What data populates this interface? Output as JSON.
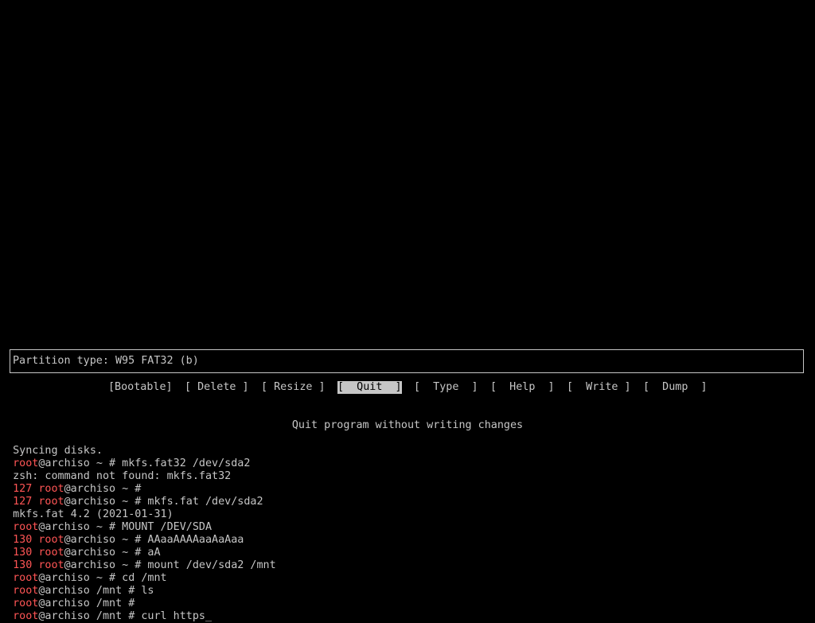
{
  "colors": {
    "background": "#000000",
    "text": "#c6c6c6",
    "prompt_user": "#ff5555",
    "selected_bg": "#c6c6c6"
  },
  "cfdisk": {
    "info": "Partition type: W95 FAT32 (b)",
    "menu": [
      {
        "label": "[Bootable]",
        "selected": false
      },
      {
        "label": "[ Delete ]",
        "selected": false
      },
      {
        "label": "[ Resize ]",
        "selected": false
      },
      {
        "label": "[  Quit  ]",
        "selected": true
      },
      {
        "label": "[  Type  ]",
        "selected": false
      },
      {
        "label": "[  Help  ]",
        "selected": false
      },
      {
        "label": "[  Write ]",
        "selected": false
      },
      {
        "label": "[  Dump  ]",
        "selected": false
      }
    ],
    "help": "Quit program without writing changes"
  },
  "terminal": {
    "lines": [
      {
        "code": "",
        "user": "",
        "host": "",
        "rest": "Syncing disks."
      },
      {
        "code": "",
        "user": "root",
        "host": "@archiso",
        "rest": " ~ # mkfs.fat32 /dev/sda2"
      },
      {
        "code": "",
        "user": "",
        "host": "",
        "rest": "zsh: command not found: mkfs.fat32"
      },
      {
        "code": "127 ",
        "user": "root",
        "host": "@archiso",
        "rest": " ~ #"
      },
      {
        "code": "127 ",
        "user": "root",
        "host": "@archiso",
        "rest": " ~ # mkfs.fat /dev/sda2"
      },
      {
        "code": "",
        "user": "",
        "host": "",
        "rest": "mkfs.fat 4.2 (2021-01-31)"
      },
      {
        "code": "",
        "user": "root",
        "host": "@archiso",
        "rest": " ~ # MOUNT /DEV/SDA"
      },
      {
        "code": "130 ",
        "user": "root",
        "host": "@archiso",
        "rest": " ~ # AAaaAAAAaaAaAaa"
      },
      {
        "code": "130 ",
        "user": "root",
        "host": "@archiso",
        "rest": " ~ # aA"
      },
      {
        "code": "130 ",
        "user": "root",
        "host": "@archiso",
        "rest": " ~ # mount /dev/sda2 /mnt"
      },
      {
        "code": "",
        "user": "root",
        "host": "@archiso",
        "rest": " ~ # cd /mnt"
      },
      {
        "code": "",
        "user": "root",
        "host": "@archiso",
        "rest": " /mnt # ls"
      },
      {
        "code": "",
        "user": "root",
        "host": "@archiso",
        "rest": " /mnt #"
      },
      {
        "code": "",
        "user": "root",
        "host": "@archiso",
        "rest": " /mnt # curl https_"
      }
    ]
  }
}
